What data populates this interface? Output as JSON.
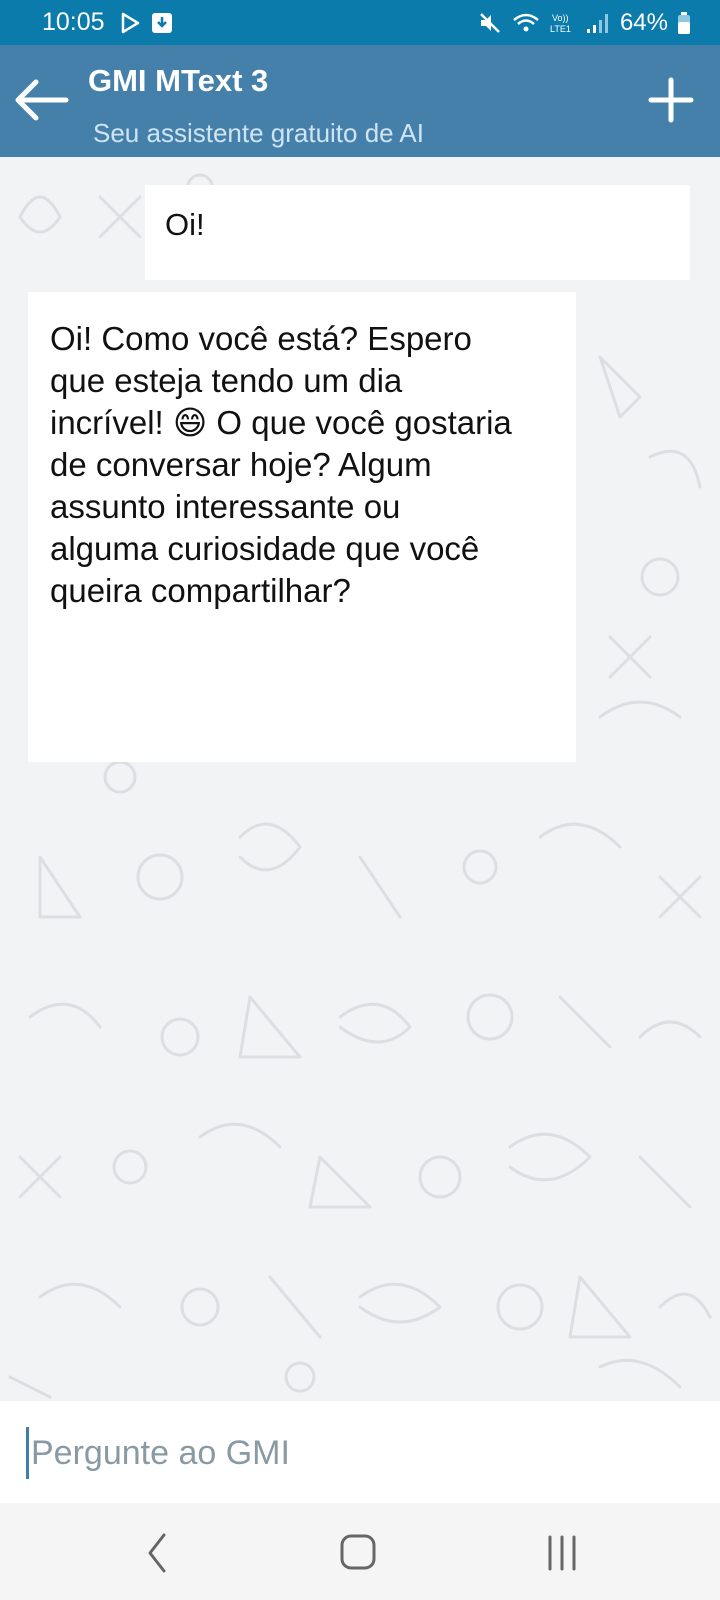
{
  "status_bar": {
    "time": "10:05",
    "battery": "64%",
    "icons": [
      "play-store-icon",
      "download-icon",
      "mute-icon",
      "wifi-icon",
      "volte-icon",
      "signal-icon",
      "battery-icon"
    ]
  },
  "header": {
    "title": "GMI MText 3",
    "subtitle": "Seu assistente gratuito de AI",
    "background_color": "#4580ab"
  },
  "messages": [
    {
      "role": "user",
      "text": "Oi!"
    },
    {
      "role": "assistant",
      "lines": [
        "Oi! Como você está? Espero",
        "que esteja tendo um dia",
        "incrível! 😄 O que você gostaria",
        "de conversar hoje? Algum",
        "assunto interessante ou",
        "alguma curiosidade que você",
        "queira compartilhar?"
      ]
    }
  ],
  "input": {
    "placeholder": "Pergunte ao GMI",
    "value": ""
  },
  "nav": {
    "buttons": [
      "back",
      "home",
      "recents"
    ]
  }
}
